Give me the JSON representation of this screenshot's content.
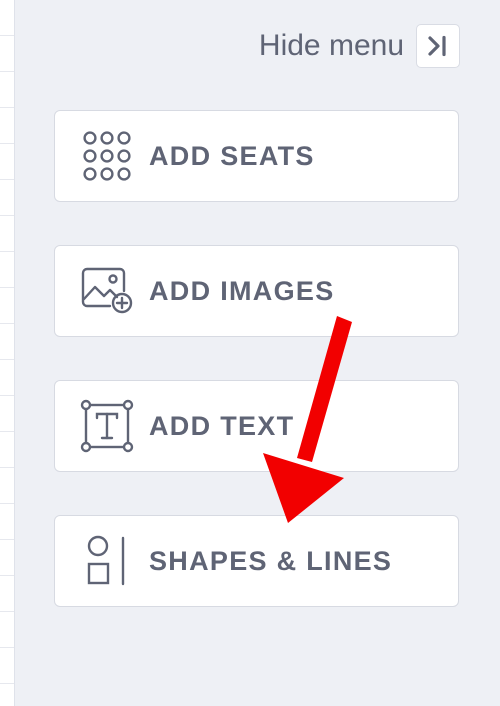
{
  "sidebar": {
    "hide_menu": {
      "label": "Hide menu",
      "icon": "collapse-right-icon"
    },
    "items": [
      {
        "label": "ADD SEATS",
        "icon": "seat-grid-icon"
      },
      {
        "label": "ADD IMAGES",
        "icon": "add-image-icon"
      },
      {
        "label": "ADD TEXT",
        "icon": "text-box-icon"
      },
      {
        "label": "SHAPES & LINES",
        "icon": "shapes-icon"
      }
    ]
  },
  "annotation": {
    "color": "#f20000",
    "icon": "red-arrow"
  },
  "colors": {
    "text": "#5f6475",
    "background": "#eef0f5",
    "button_bg": "#ffffff",
    "border": "#d7dae2"
  }
}
